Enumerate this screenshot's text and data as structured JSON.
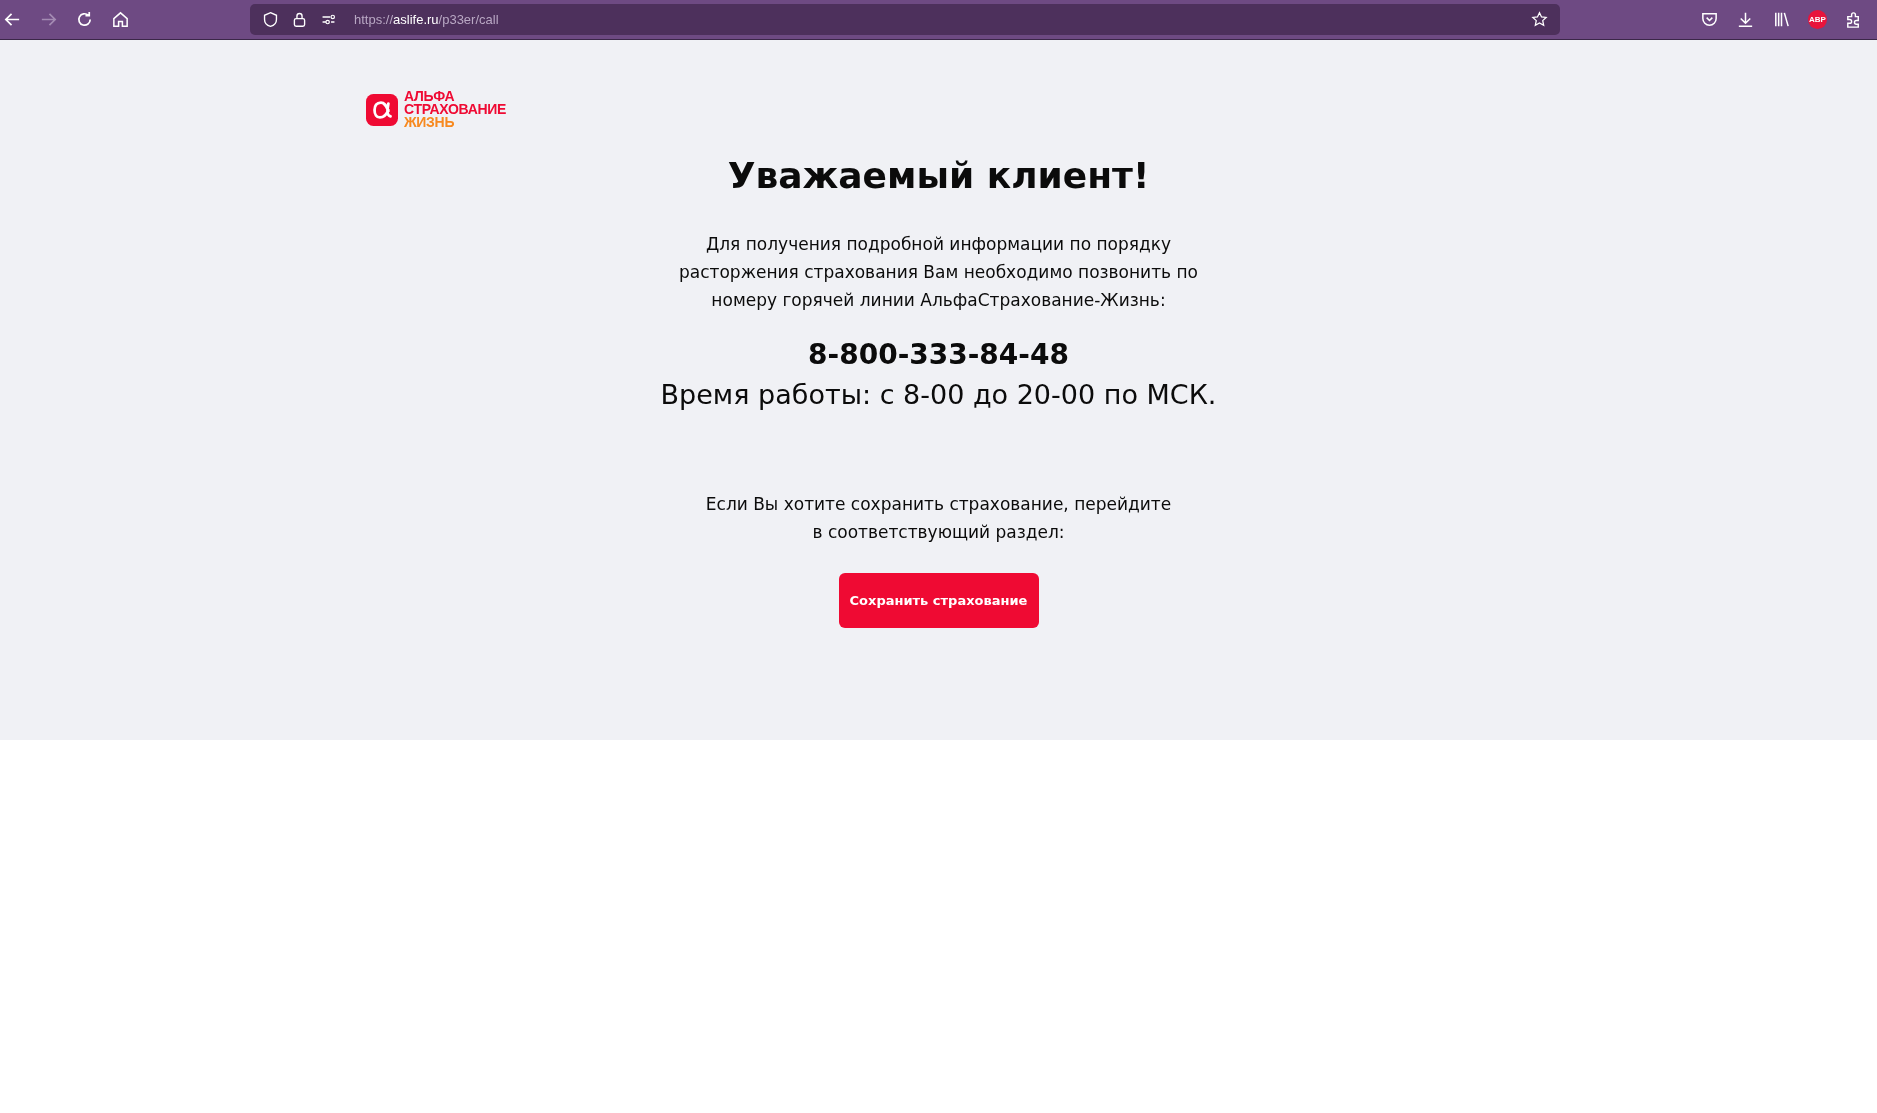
{
  "browser": {
    "url": {
      "scheme": "https://",
      "host": "aslife.ru",
      "path": "/p33er/call"
    },
    "forward_disabled": true,
    "extension_badge": "ABP"
  },
  "logo": {
    "lines": [
      {
        "text": "АЛЬФА",
        "color": "#ef0a33"
      },
      {
        "text": "СТРАХОВАНИЕ",
        "color": "#ef0a33"
      },
      {
        "text": "ЖИЗНЬ",
        "color": "#f7891f"
      }
    ]
  },
  "heading": "Уважаемый клиент!",
  "intro": "Для получения подробной информации по порядку расторжения страхования Вам необходимо позвонить по номеру горячей линии АльфаСтрахование-Жизнь:",
  "phone": "8-800-333-84-48",
  "hours": "Время работы: с 8-00 до 20-00 по МСК.",
  "keep_text": "Если Вы хотите сохранить страхование, перейдите в соответствующий раздел:",
  "keep_button": "Сохранить страхование"
}
